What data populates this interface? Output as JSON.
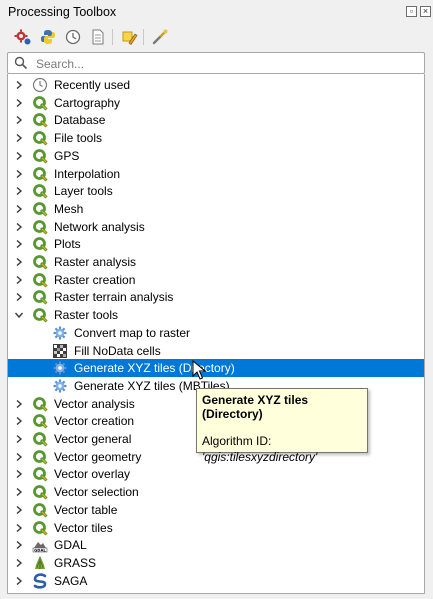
{
  "panel": {
    "title": "Processing Toolbox"
  },
  "toolbar": {
    "buttons": [
      "models-icon",
      "python-icon",
      "history-icon",
      "results-icon",
      "edit-features-icon",
      "options-icon"
    ]
  },
  "search": {
    "placeholder": "Search..."
  },
  "tree": {
    "items": [
      {
        "label": "Recently used",
        "icon": "clock-icon",
        "expand": "collapsed",
        "level": 0
      },
      {
        "label": "Cartography",
        "icon": "qgis-icon",
        "expand": "collapsed",
        "level": 0
      },
      {
        "label": "Database",
        "icon": "qgis-icon",
        "expand": "collapsed",
        "level": 0
      },
      {
        "label": "File tools",
        "icon": "qgis-icon",
        "expand": "collapsed",
        "level": 0
      },
      {
        "label": "GPS",
        "icon": "qgis-icon",
        "expand": "collapsed",
        "level": 0
      },
      {
        "label": "Interpolation",
        "icon": "qgis-icon",
        "expand": "collapsed",
        "level": 0
      },
      {
        "label": "Layer tools",
        "icon": "qgis-icon",
        "expand": "collapsed",
        "level": 0
      },
      {
        "label": "Mesh",
        "icon": "qgis-icon",
        "expand": "collapsed",
        "level": 0
      },
      {
        "label": "Network analysis",
        "icon": "qgis-icon",
        "expand": "collapsed",
        "level": 0
      },
      {
        "label": "Plots",
        "icon": "qgis-icon",
        "expand": "collapsed",
        "level": 0
      },
      {
        "label": "Raster analysis",
        "icon": "qgis-icon",
        "expand": "collapsed",
        "level": 0
      },
      {
        "label": "Raster creation",
        "icon": "qgis-icon",
        "expand": "collapsed",
        "level": 0
      },
      {
        "label": "Raster terrain analysis",
        "icon": "qgis-icon",
        "expand": "collapsed",
        "level": 0
      },
      {
        "label": "Raster tools",
        "icon": "qgis-icon",
        "expand": "expanded",
        "level": 0
      },
      {
        "label": "Convert map to raster",
        "icon": "gear-icon",
        "expand": "none",
        "level": 1
      },
      {
        "label": "Fill NoData cells",
        "icon": "raster-grid-icon",
        "expand": "none",
        "level": 1
      },
      {
        "label": "Generate XYZ tiles (Directory)",
        "icon": "gear-icon",
        "expand": "none",
        "level": 1,
        "selected": true
      },
      {
        "label": "Generate XYZ tiles (MBTiles)",
        "icon": "gear-icon",
        "expand": "none",
        "level": 1
      },
      {
        "label": "Vector analysis",
        "icon": "qgis-icon",
        "expand": "collapsed",
        "level": 0
      },
      {
        "label": "Vector creation",
        "icon": "qgis-icon",
        "expand": "collapsed",
        "level": 0
      },
      {
        "label": "Vector general",
        "icon": "qgis-icon",
        "expand": "collapsed",
        "level": 0
      },
      {
        "label": "Vector geometry",
        "icon": "qgis-icon",
        "expand": "collapsed",
        "level": 0
      },
      {
        "label": "Vector overlay",
        "icon": "qgis-icon",
        "expand": "collapsed",
        "level": 0
      },
      {
        "label": "Vector selection",
        "icon": "qgis-icon",
        "expand": "collapsed",
        "level": 0
      },
      {
        "label": "Vector table",
        "icon": "qgis-icon",
        "expand": "collapsed",
        "level": 0
      },
      {
        "label": "Vector tiles",
        "icon": "qgis-icon",
        "expand": "collapsed",
        "level": 0
      },
      {
        "label": "GDAL",
        "icon": "gdal-icon",
        "expand": "collapsed",
        "level": 0
      },
      {
        "label": "GRASS",
        "icon": "grass-icon",
        "expand": "collapsed",
        "level": 0
      },
      {
        "label": "SAGA",
        "icon": "saga-icon",
        "expand": "collapsed",
        "level": 0
      }
    ]
  },
  "tooltip": {
    "title": "Generate XYZ tiles (Directory)",
    "id_label": "Algorithm ID:",
    "id_value": "'qgis:tilesxyzdirectory'"
  },
  "colors": {
    "selection": "#0078d7",
    "qgis_green": "#589632",
    "tooltip_bg": "#ffffdc"
  }
}
